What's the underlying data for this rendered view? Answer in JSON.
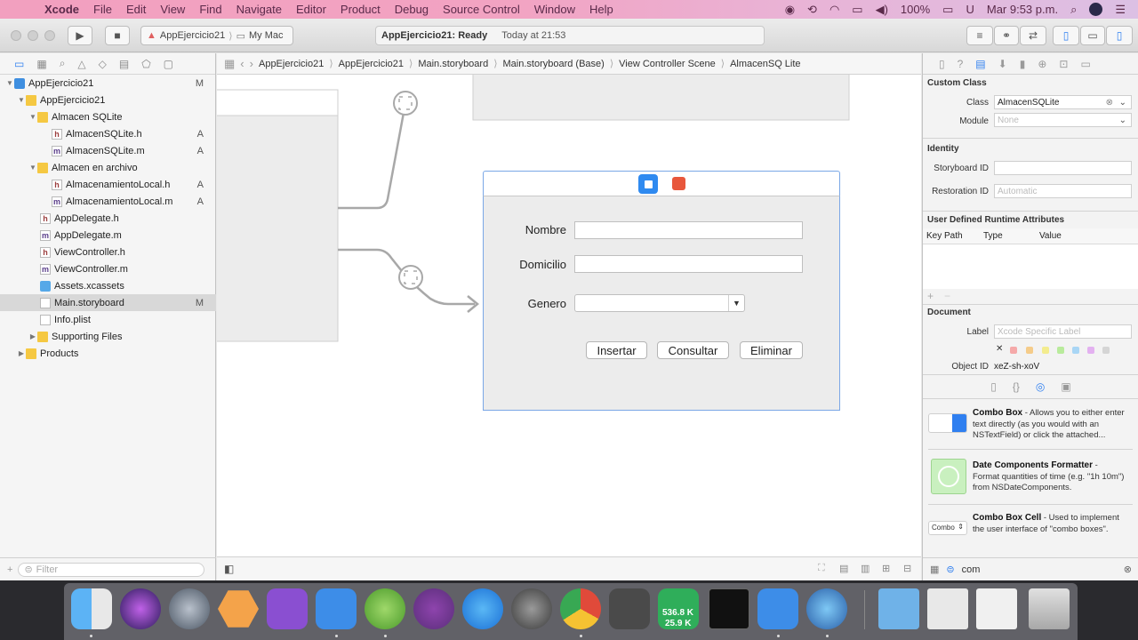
{
  "menubar": {
    "app": "Xcode",
    "items": [
      "File",
      "Edit",
      "View",
      "Find",
      "Navigate",
      "Editor",
      "Product",
      "Debug",
      "Source Control",
      "Window",
      "Help"
    ],
    "battery": "100%",
    "clock": "Mar 9:53 p.m."
  },
  "toolbar": {
    "scheme": "AppEjercicio21",
    "destination": "My Mac",
    "status_project": "AppEjercicio21: Ready",
    "status_time": "Today at 21:53"
  },
  "navigator": {
    "filter_placeholder": "Filter",
    "tree": [
      {
        "label": "AppEjercicio21",
        "badge": "M"
      },
      {
        "label": "AppEjercicio21",
        "badge": ""
      },
      {
        "label": "Almacen SQLite",
        "badge": ""
      },
      {
        "label": "AlmacenSQLite.h",
        "badge": "A"
      },
      {
        "label": "AlmacenSQLite.m",
        "badge": "A"
      },
      {
        "label": "Almacen en archivo",
        "badge": ""
      },
      {
        "label": "AlmacenamientoLocal.h",
        "badge": "A"
      },
      {
        "label": "AlmacenamientoLocal.m",
        "badge": "A"
      },
      {
        "label": "AppDelegate.h",
        "badge": ""
      },
      {
        "label": "AppDelegate.m",
        "badge": ""
      },
      {
        "label": "ViewController.h",
        "badge": ""
      },
      {
        "label": "ViewController.m",
        "badge": ""
      },
      {
        "label": "Assets.xcassets",
        "badge": ""
      },
      {
        "label": "Main.storyboard",
        "badge": "M"
      },
      {
        "label": "Info.plist",
        "badge": ""
      },
      {
        "label": "Supporting Files",
        "badge": ""
      },
      {
        "label": "Products",
        "badge": ""
      }
    ]
  },
  "jumpbar": {
    "crumbs": [
      "AppEjercicio21",
      "AppEjercicio21",
      "Main.storyboard",
      "Main.storyboard (Base)",
      "View Controller Scene",
      "AlmacenSQ Lite"
    ]
  },
  "form": {
    "nombre_label": "Nombre",
    "domicilio_label": "Domicilio",
    "genero_label": "Genero",
    "insertar": "Insertar",
    "consultar": "Consultar",
    "eliminar": "Eliminar"
  },
  "inspector": {
    "custom_class_title": "Custom Class",
    "class_label": "Class",
    "class_value": "AlmacenSQLite",
    "module_label": "Module",
    "module_value": "None",
    "identity_title": "Identity",
    "storyboard_id_label": "Storyboard ID",
    "restoration_id_label": "Restoration ID",
    "restoration_id_placeholder": "Automatic",
    "runtime_title": "User Defined Runtime Attributes",
    "col_key_path": "Key Path",
    "col_type": "Type",
    "col_value": "Value",
    "document_title": "Document",
    "label_label": "Label",
    "label_placeholder": "Xcode Specific Label",
    "object_id_label": "Object ID",
    "object_id_value": "xeZ-sh-xoV",
    "library": [
      {
        "name": "Combo Box",
        "desc": " - Allows you to either enter text directly (as you would with an NSTextField) or click the attached..."
      },
      {
        "name": "Date Components Formatter",
        "desc": " - Format quantities of time (e.g. \"1h 10m\") from NSDateComponents."
      },
      {
        "name": "Combo Box Cell",
        "desc": " - Used to implement the user interface of \"combo boxes\"."
      }
    ],
    "combo_thumb_text": "Combo",
    "library_filter": "com"
  },
  "dock": {
    "net_up": "536.8 K",
    "net_down": "25.9 K"
  }
}
